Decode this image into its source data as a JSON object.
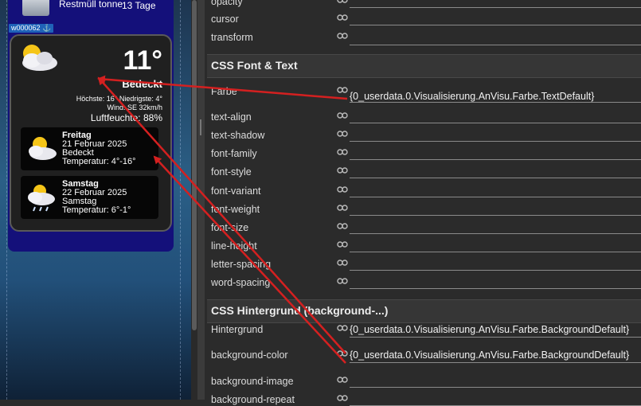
{
  "top_widget": {
    "label": "Restmüll tonne",
    "days": "13 Tage"
  },
  "widget_tag": "w000062 ⚓",
  "weather": {
    "temp": "11°",
    "condition": "Bedeckt",
    "hilo": "Höchste: 16° Niedrigste: 4°",
    "wind": "Wind: SE 32km/h",
    "humidity": "Luftfeuchte: 88%",
    "days": [
      {
        "day": "Freitag",
        "date": "21 Februar 2025",
        "cond": "Bedeckt",
        "temp": "Temperatur: 4°-16°"
      },
      {
        "day": "Samstag",
        "date": "22 Februar 2025",
        "cond": "Samstag",
        "temp": "Temperatur: 6°-1°"
      }
    ]
  },
  "props": {
    "top_rows": [
      "opacity",
      "cursor",
      "transform"
    ],
    "sections": [
      {
        "title": "CSS Font & Text",
        "rows": [
          {
            "name": "Farbe",
            "value": "{0_userdata.0.Visualisierung.AnVisu.Farbe.TextDefault}"
          },
          {
            "name": "text-align",
            "value": ""
          },
          {
            "name": "text-shadow",
            "value": ""
          },
          {
            "name": "font-family",
            "value": ""
          },
          {
            "name": "font-style",
            "value": ""
          },
          {
            "name": "font-variant",
            "value": ""
          },
          {
            "name": "font-weight",
            "value": ""
          },
          {
            "name": "font-size",
            "value": ""
          },
          {
            "name": "line-height",
            "value": ""
          },
          {
            "name": "letter-spacing",
            "value": ""
          },
          {
            "name": "word-spacing",
            "value": ""
          }
        ]
      },
      {
        "title": "CSS Hintergrund (background-...)",
        "rows": [
          {
            "name": "Hintergrund",
            "value": "{0_userdata.0.Visualisierung.AnVisu.Farbe.BackgroundDefault}"
          },
          {
            "name": "background-color",
            "value": "{0_userdata.0.Visualisierung.AnVisu.Farbe.BackgroundDefault}"
          },
          {
            "name": "background-image",
            "value": ""
          },
          {
            "name": "background-repeat",
            "value": ""
          }
        ]
      }
    ]
  },
  "colors": {
    "accent_arrow": "#d42020",
    "widget_bg": "#14107a",
    "tag_bg": "#1f63b8"
  }
}
